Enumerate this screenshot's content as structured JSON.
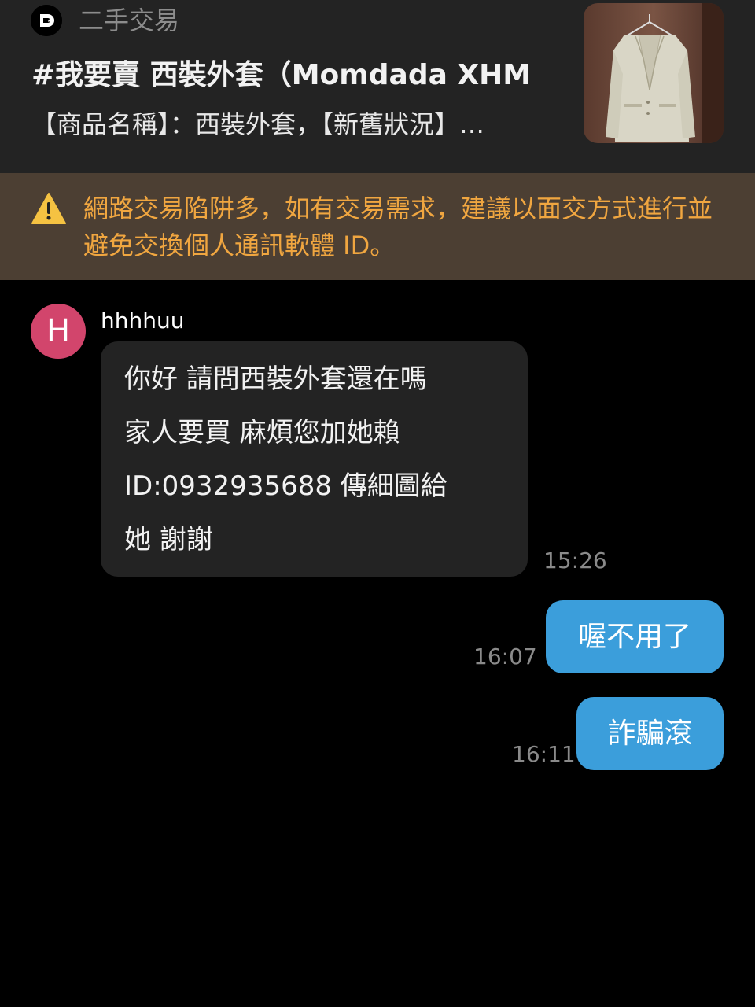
{
  "post": {
    "board_name": "二手交易",
    "title": "#我要賣 西裝外套（Momdada XHM",
    "excerpt": "【商品名稱】：西裝外套，【新舊狀況】…",
    "board_icon": "board-logo-icon",
    "thumbnail": "cream-blazer-photo"
  },
  "warning": {
    "icon": "warning-triangle-icon",
    "text": "網路交易陷阱多，如有交易需求，建議以面交方式進行並避免交換個人通訊軟體 ID。"
  },
  "messages": [
    {
      "direction": "incoming",
      "avatar_initial": "H",
      "sender": "hhhhuu",
      "lines": [
        "你好 請問西裝外套還在嗎",
        "家人要買 麻煩您加她賴",
        "ID:0932935688 傳細圖給",
        "她 謝謝"
      ],
      "time": "15:26"
    },
    {
      "direction": "outgoing",
      "text": "喔不用了",
      "time": "16:07"
    },
    {
      "direction": "outgoing",
      "text": "詐騙滾",
      "time": "16:11"
    }
  ],
  "colors": {
    "background": "#000000",
    "header": "#232323",
    "warning_bg": "#4c3f33",
    "warning_text": "#f0a640",
    "outgoing_bubble": "#3b9edb",
    "incoming_bubble": "#232323",
    "avatar": "#d2456c"
  }
}
